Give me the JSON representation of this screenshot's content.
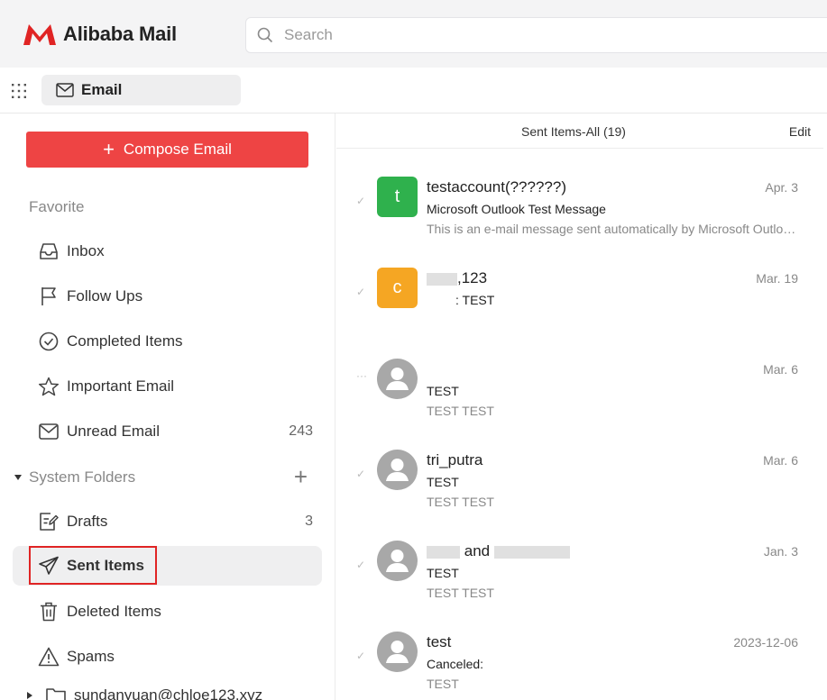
{
  "app": {
    "title": "Alibaba Mail",
    "brand_color": "#e02424"
  },
  "search": {
    "placeholder": "Search"
  },
  "tabs": {
    "email_label": "Email"
  },
  "sidebar": {
    "compose_label": "Compose Email",
    "favorite_title": "Favorite",
    "favorites": [
      {
        "label": "Inbox",
        "icon": "inbox-icon"
      },
      {
        "label": "Follow Ups",
        "icon": "flag-icon"
      },
      {
        "label": "Completed Items",
        "icon": "check-circle-icon"
      },
      {
        "label": "Important Email",
        "icon": "star-icon"
      },
      {
        "label": "Unread Email",
        "icon": "envelope-icon",
        "count": "243"
      }
    ],
    "system_folders_title": "System Folders",
    "folders": [
      {
        "label": "Drafts",
        "icon": "drafts-icon",
        "count": "3"
      },
      {
        "label": "Sent Items",
        "icon": "send-icon",
        "active": true
      },
      {
        "label": "Deleted Items",
        "icon": "trash-icon"
      },
      {
        "label": "Spams",
        "icon": "warning-icon"
      }
    ],
    "extra_folder": "sundanyuan@chloe123.xyz"
  },
  "list": {
    "title": "Sent Items-All (19)",
    "edit_label": "Edit",
    "messages": [
      {
        "avatar_letter": "t",
        "avatar_color": "#2fb14d",
        "sender": "testaccount(??????)",
        "date": "Apr. 3",
        "subject": "Microsoft Outlook Test Message",
        "preview": "This is an e-mail message sent automatically by Microsoft Outlook while testing the settings for your account."
      },
      {
        "avatar_letter": "c",
        "avatar_color": "#f5a623",
        "sender": ",123",
        "date": "Mar. 19",
        "subject": ":  TEST",
        "preview": ""
      },
      {
        "avatar_letter": "",
        "avatar_color": "#a8a8a8",
        "sender": "",
        "date": "Mar. 6",
        "subject": "TEST",
        "preview": "TEST TEST"
      },
      {
        "avatar_letter": "",
        "avatar_color": "#a8a8a8",
        "sender": "tri_putra",
        "date": "Mar. 6",
        "subject": "TEST",
        "preview": "TEST TEST"
      },
      {
        "avatar_letter": "",
        "avatar_color": "#a8a8a8",
        "sender": "and",
        "date": "Jan. 3",
        "subject": "TEST",
        "preview": "TEST TEST"
      },
      {
        "avatar_letter": "",
        "avatar_color": "#a8a8a8",
        "sender": "test",
        "date": "2023-12-06",
        "subject": "Canceled:",
        "preview": "TEST"
      }
    ]
  }
}
